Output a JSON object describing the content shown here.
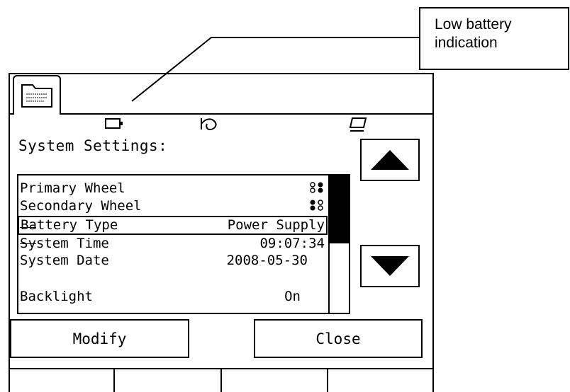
{
  "callout": {
    "line1": "Low battery",
    "line2": "indication"
  },
  "status_icons": {
    "battery": "battery-icon",
    "wrench": "service-icon",
    "display": "display-icon"
  },
  "screen": {
    "title": "System Settings:",
    "rows": [
      {
        "label": "Primary Wheel",
        "value": ""
      },
      {
        "label": "Secondary Wheel",
        "value": ""
      },
      {
        "label": "Battery Type",
        "value": "Power Supply"
      },
      {
        "label": "System Time",
        "value": "09:07:34"
      },
      {
        "label": "System Date",
        "value": "2008-05-30"
      },
      {
        "label": "Backlight",
        "value": "On"
      }
    ],
    "buttons": {
      "modify": "Modify",
      "close": "Close"
    }
  }
}
